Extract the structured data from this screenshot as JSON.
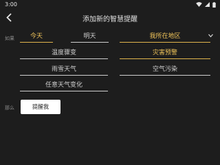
{
  "status_bar": {
    "time": "3:00"
  },
  "header": {
    "title": "添加新的智慧提醒"
  },
  "conditions": {
    "if_label": "如果",
    "options": [
      {
        "label": "今天",
        "selected": true
      },
      {
        "label": "明天",
        "selected": false
      },
      {
        "label": "我所在地区",
        "selected": true
      },
      {
        "label": "温度骤变",
        "selected": false
      },
      {
        "label": "灾害预警",
        "selected": true
      },
      {
        "label": "雨雪天气",
        "selected": false
      },
      {
        "label": "空气污染",
        "selected": false
      },
      {
        "label": "任意天气变化",
        "selected": false
      }
    ]
  },
  "action": {
    "then_label": "那么",
    "button_label": "提醒我"
  },
  "colors": {
    "accent": "#e2b64d",
    "background": "#1d1d1d"
  }
}
